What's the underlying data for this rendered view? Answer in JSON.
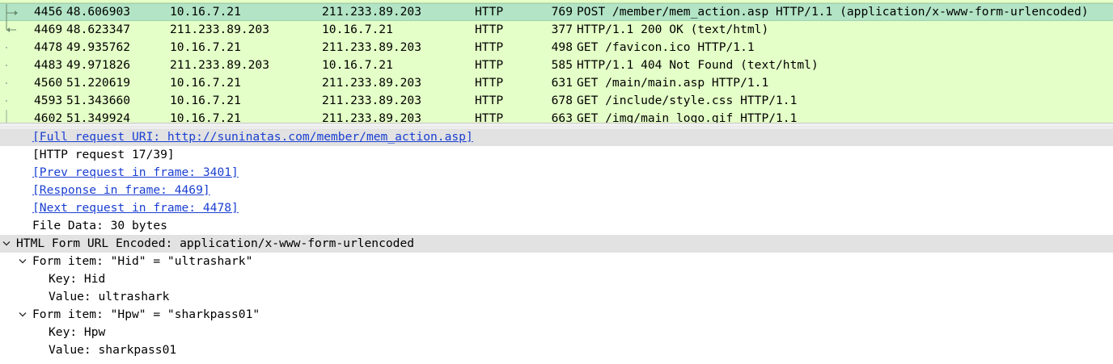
{
  "packet_list": {
    "rows": [
      {
        "no": "4456",
        "time": "48.606903",
        "src": "10.16.7.21",
        "dst": "211.233.89.203",
        "proto": "HTTP",
        "len": "769",
        "info": "POST /member/mem_action.asp HTTP/1.1  (application/x-www-form-urlencoded)",
        "selected": true,
        "rel": "request"
      },
      {
        "no": "4469",
        "time": "48.623347",
        "src": "211.233.89.203",
        "dst": "10.16.7.21",
        "proto": "HTTP",
        "len": "377",
        "info": "HTTP/1.1 200 OK  (text/html)",
        "selected": false,
        "rel": "response"
      },
      {
        "no": "4478",
        "time": "49.935762",
        "src": "10.16.7.21",
        "dst": "211.233.89.203",
        "proto": "HTTP",
        "len": "498",
        "info": "GET /favicon.ico HTTP/1.1",
        "selected": false,
        "rel": "line"
      },
      {
        "no": "4483",
        "time": "49.971826",
        "src": "211.233.89.203",
        "dst": "10.16.7.21",
        "proto": "HTTP",
        "len": "585",
        "info": "HTTP/1.1 404 Not Found  (text/html)",
        "selected": false,
        "rel": "line"
      },
      {
        "no": "4560",
        "time": "51.220619",
        "src": "10.16.7.21",
        "dst": "211.233.89.203",
        "proto": "HTTP",
        "len": "631",
        "info": "GET /main/main.asp HTTP/1.1",
        "selected": false,
        "rel": "line"
      },
      {
        "no": "4593",
        "time": "51.343660",
        "src": "10.16.7.21",
        "dst": "211.233.89.203",
        "proto": "HTTP",
        "len": "678",
        "info": "GET /include/style.css HTTP/1.1",
        "selected": false,
        "rel": "line"
      },
      {
        "no": "4602",
        "time": "51.349924",
        "src": "10.16.7.21",
        "dst": "211.233.89.203",
        "proto": "HTTP",
        "len": "663",
        "info": "GET /img/main_logo.gif HTTP/1.1",
        "selected": false,
        "rel": "line"
      }
    ]
  },
  "details": {
    "full_request_uri": "[Full request URI: http://suninatas.com/member/mem_action.asp]",
    "http_request": "[HTTP request 17/39]",
    "prev_request": "[Prev request in frame: 3401]",
    "response_in": "[Response in frame: 4469]",
    "next_request": "[Next request in frame: 4478]",
    "file_data": "File Data: 30 bytes",
    "html_form": "HTML Form URL Encoded: application/x-www-form-urlencoded",
    "form_item_1": {
      "label": "Form item: \"Hid\" = \"ultrashark\"",
      "key": "Key: Hid",
      "value": "Value: ultrashark"
    },
    "form_item_2": {
      "label": "Form item: \"Hpw\" = \"sharkpass01\"",
      "key": "Key: Hpw",
      "value": "Value: sharkpass01"
    }
  },
  "colors": {
    "http_row_bg": "#e4ffc7",
    "selected_row_bg": "#b2e4c5",
    "link": "#1a3fd1",
    "highlight_row_bg": "#e2e2e2"
  },
  "icons": {
    "expanded": "chevron-down-icon",
    "request_arrow": "arrow-right-icon",
    "response_arrow": "arrow-left-icon"
  }
}
